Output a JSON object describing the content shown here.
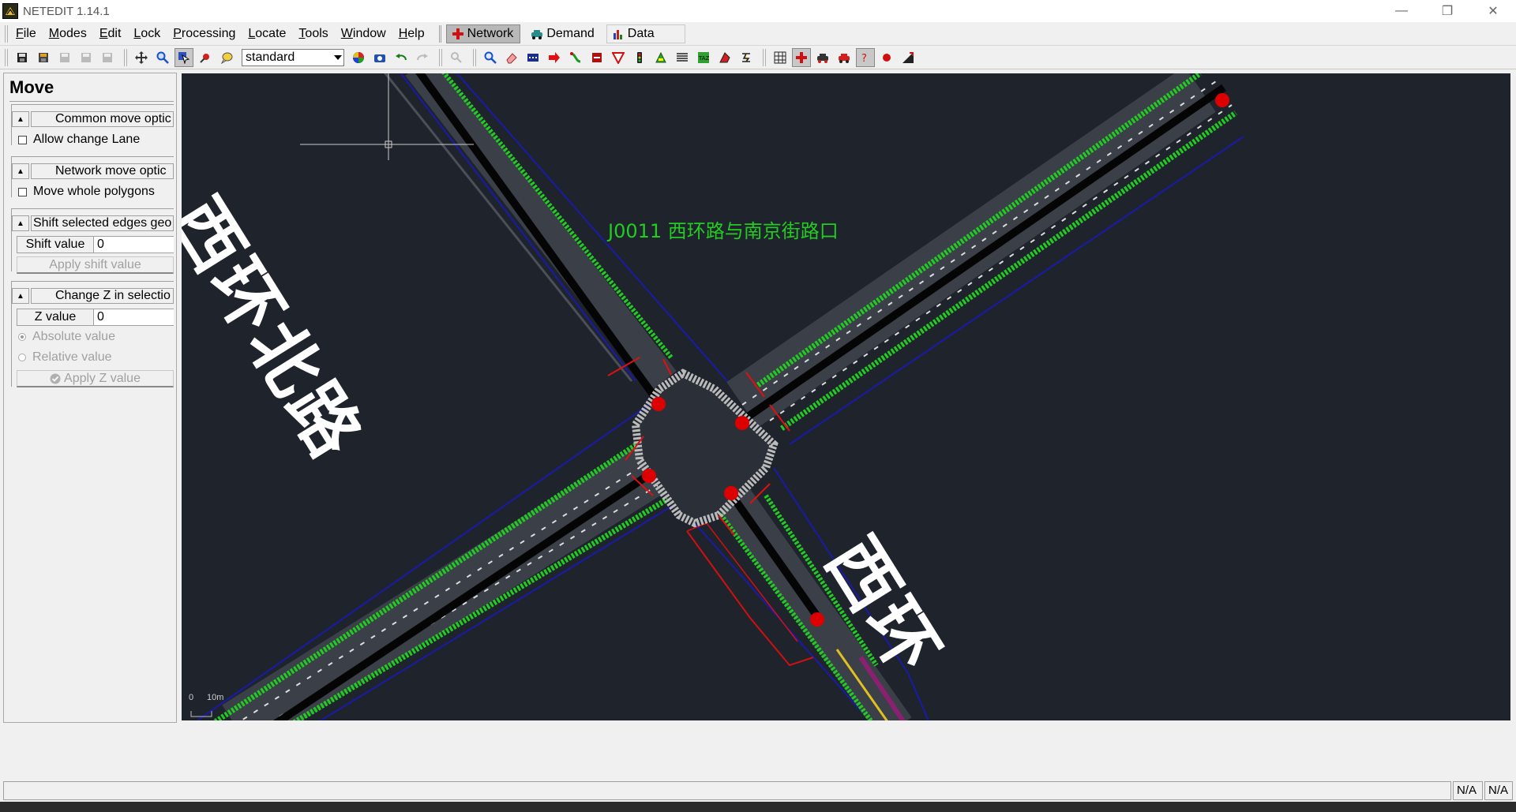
{
  "window": {
    "title": "NETEDIT 1.14.1"
  },
  "menu": {
    "items": [
      {
        "label": "File",
        "underline": "F",
        "rest": "ile"
      },
      {
        "label": "Modes",
        "underline": "M",
        "rest": "odes"
      },
      {
        "label": "Edit",
        "underline": "E",
        "rest": "dit"
      },
      {
        "label": "Lock",
        "underline": "L",
        "rest": "ock"
      },
      {
        "label": "Processing",
        "underline": "P",
        "rest": "rocessing"
      },
      {
        "label": "Locate",
        "underline": "L",
        "rest": "ocate"
      },
      {
        "label": "Tools",
        "underline": "T",
        "rest": "ools"
      },
      {
        "label": "Window",
        "underline": "W",
        "rest": "indow"
      },
      {
        "label": "Help",
        "underline": "H",
        "rest": "elp"
      }
    ],
    "modes": {
      "network": "Network",
      "demand": "Demand",
      "data": "Data"
    }
  },
  "toolbar": {
    "scheme_value": "standard"
  },
  "move_panel": {
    "title": "Move",
    "common_group": "Common move optic",
    "allow_change_lane": "Allow change Lane",
    "network_group": "Network move optic",
    "move_whole_polygons": "Move whole polygons",
    "shift_group": "Shift selected edges geo",
    "shift_label": "Shift value",
    "shift_value": "0",
    "apply_shift": "Apply shift value",
    "z_group": "Change Z in selectio",
    "z_label": "Z value",
    "z_value": "0",
    "absolute": "Absolute value",
    "relative": "Relative value",
    "apply_z": "Apply Z value"
  },
  "canvas": {
    "junction_label": "J0011 西环路与南京街路口",
    "road_label_nw": "西环北路",
    "road_label_se": "西环",
    "scale_zero": "0",
    "scale_len": "10m"
  },
  "status": {
    "field1": "N/A",
    "field2": "N/A"
  },
  "colors": {
    "canvas_bg": "#1f242c",
    "lane_green": "#22cc22",
    "road_border": "#1a1aa0",
    "junction_dot": "#dd0000"
  }
}
